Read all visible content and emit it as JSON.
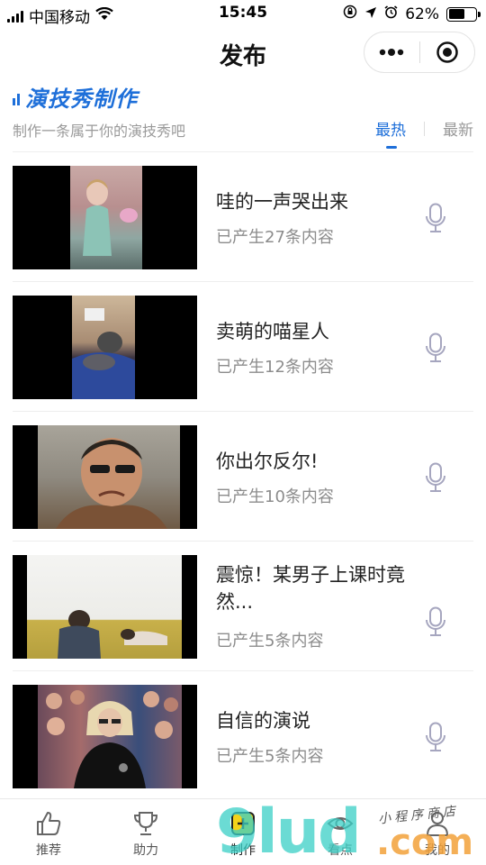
{
  "status_bar": {
    "carrier": "中国移动",
    "time": "15:45",
    "battery_percent": "62%",
    "battery_level": 0.62,
    "icons": [
      "signal-icon",
      "wifi-icon",
      "rotation-lock-icon",
      "location-icon",
      "alarm-icon",
      "battery-icon"
    ]
  },
  "nav": {
    "title": "发布",
    "capsule_icons": [
      "more-icon",
      "close-target-icon"
    ]
  },
  "section": {
    "title": "演技秀制作",
    "subtitle": "制作一条属于你的演技秀吧",
    "tabs": [
      {
        "label": "最热",
        "active": true
      },
      {
        "label": "最新",
        "active": false
      }
    ]
  },
  "items": [
    {
      "name": "哇的一声哭出来",
      "count": "已产生27条内容",
      "icon": "microphone-icon"
    },
    {
      "name": "卖萌的喵星人",
      "count": "已产生12条内容",
      "icon": "microphone-icon"
    },
    {
      "name": "你出尔反尔!",
      "count": "已产生10条内容",
      "icon": "microphone-icon"
    },
    {
      "name": "震惊！某男子上课时竟然...",
      "count": "已产生5条内容",
      "icon": "microphone-icon"
    },
    {
      "name": "自信的演说",
      "count": "已产生5条内容",
      "icon": "microphone-icon"
    }
  ],
  "tabbar": [
    {
      "label": "推荐",
      "icon": "thumbs-up-icon"
    },
    {
      "label": "助力",
      "icon": "trophy-icon"
    },
    {
      "label": "制作",
      "icon": "add-icon",
      "active": true
    },
    {
      "label": "看点",
      "icon": "eye-icon"
    },
    {
      "label": "我的",
      "icon": "user-icon"
    }
  ],
  "watermark": {
    "big_text": "9lud",
    "dotcom": ".com",
    "small_text": "小程序商店"
  },
  "colors": {
    "accent": "#1e6fd9",
    "muted": "#9a9a9a",
    "mic": "#a6a6bf"
  }
}
